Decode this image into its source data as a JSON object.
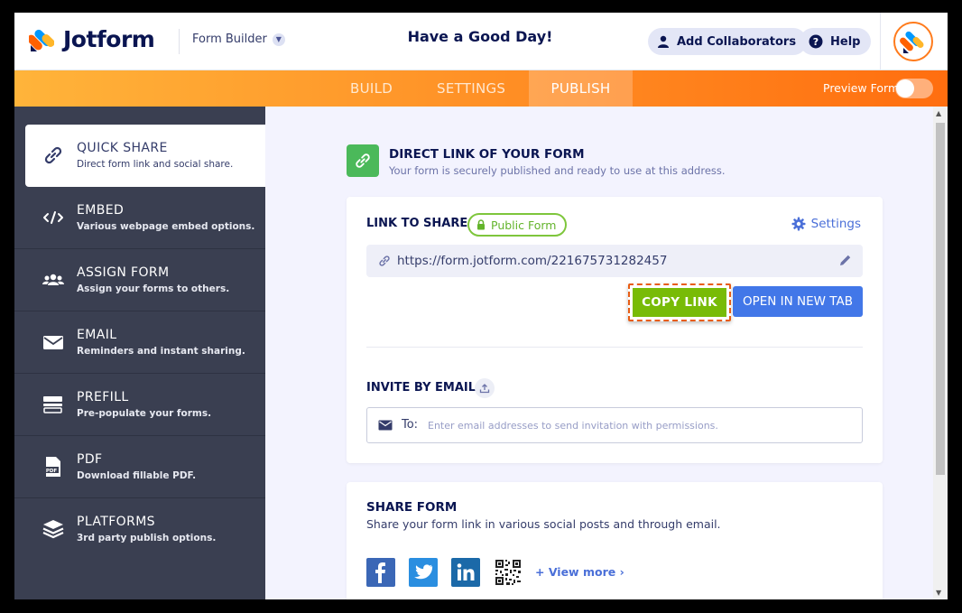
{
  "header": {
    "brand": "Jotform",
    "builder_label": "Form Builder",
    "greeting": "Have a Good Day!",
    "add_collaborators": "Add Collaborators",
    "help": "Help"
  },
  "nav": {
    "tabs": [
      "BUILD",
      "SETTINGS",
      "PUBLISH"
    ],
    "active_tab": "PUBLISH",
    "preview_label": "Preview Form",
    "preview_enabled": false
  },
  "sidebar": {
    "items": [
      {
        "label": "QUICK SHARE",
        "sub": "Direct form link and social share.",
        "icon": "link-icon",
        "active": true
      },
      {
        "label": "EMBED",
        "sub": "Various webpage embed options.",
        "icon": "code-icon",
        "active": false
      },
      {
        "label": "ASSIGN FORM",
        "sub": "Assign your forms to others.",
        "icon": "users-icon",
        "active": false
      },
      {
        "label": "EMAIL",
        "sub": "Reminders and instant sharing.",
        "icon": "envelope-icon",
        "active": false
      },
      {
        "label": "PREFILL",
        "sub": "Pre-populate your forms.",
        "icon": "prefill-icon",
        "active": false
      },
      {
        "label": "PDF",
        "sub": "Download fillable PDF.",
        "icon": "pdf-icon",
        "active": false
      },
      {
        "label": "PLATFORMS",
        "sub": "3rd party publish options.",
        "icon": "layers-icon",
        "active": false
      }
    ]
  },
  "direct_link": {
    "title": "DIRECT LINK OF YOUR FORM",
    "subtitle": "Your form is securely published and ready to use at this address."
  },
  "link_card": {
    "link_to_share": "LINK TO SHARE",
    "public_badge": "Public Form",
    "settings": "Settings",
    "url": "https://form.jotform.com/221675731282457",
    "copy_link": "COPY LINK",
    "open_new_tab": "OPEN IN NEW TAB",
    "invite_title": "INVITE BY EMAIL",
    "to_label": "To:",
    "email_placeholder": "Enter email addresses to send invitation with permissions."
  },
  "share_card": {
    "title": "SHARE FORM",
    "subtitle": "Share your form link in various social posts and through email.",
    "view_more": "View more",
    "networks": [
      "facebook-icon",
      "twitter-icon",
      "linkedin-icon",
      "qr-code-icon"
    ]
  },
  "colors": {
    "brand_navy": "#0a1551",
    "nav_orange": "#ff7a12",
    "sidebar_bg": "#3a3f51",
    "copy_green": "#78bb07",
    "open_blue": "#4277e8",
    "highlight_orange": "#e85d14"
  }
}
